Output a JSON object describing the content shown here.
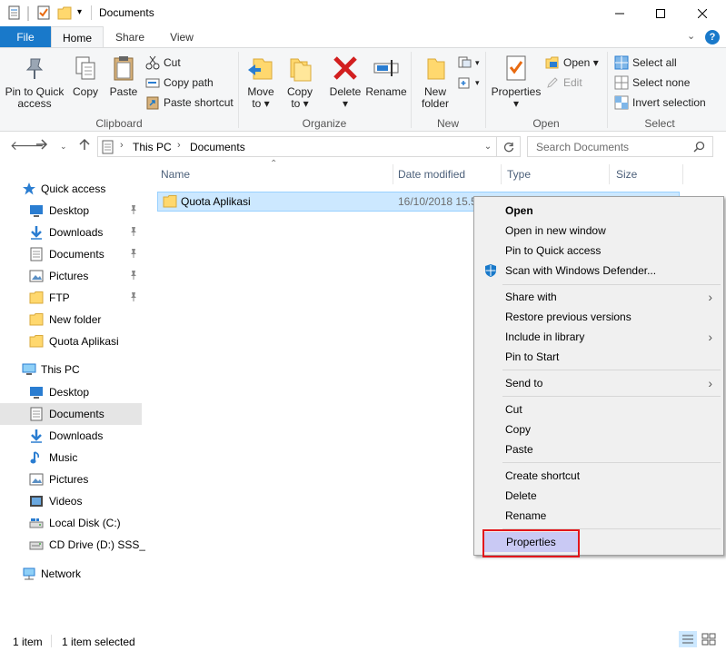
{
  "window": {
    "title": "Documents"
  },
  "ribbon": {
    "tabs": [
      "File",
      "Home",
      "Share",
      "View"
    ],
    "clipboard": {
      "group_label": "Clipboard",
      "pin_label_1": "Pin to Quick",
      "pin_label_2": "access",
      "copy": "Copy",
      "paste": "Paste",
      "cut": "Cut",
      "copy_path": "Copy path",
      "paste_shortcut": "Paste shortcut"
    },
    "organize": {
      "group_label": "Organize",
      "move_to_1": "Move",
      "move_to_2": "to ▾",
      "copy_to_1": "Copy",
      "copy_to_2": "to ▾",
      "delete_1": "Delete",
      "delete_2": "▾",
      "rename": "Rename"
    },
    "new": {
      "group_label": "New",
      "new_folder_1": "New",
      "new_folder_2": "folder"
    },
    "open": {
      "group_label": "Open",
      "properties_1": "Properties",
      "properties_2": "▾",
      "open": "Open ▾",
      "edit": "Edit"
    },
    "select": {
      "group_label": "Select",
      "select_all": "Select all",
      "select_none": "Select none",
      "invert_selection": "Invert selection"
    }
  },
  "address": {
    "crumbs": [
      "This PC",
      "Documents"
    ],
    "search_placeholder": "Search Documents"
  },
  "navpane": {
    "quick_access": "Quick access",
    "quick_items": [
      "Desktop",
      "Downloads",
      "Documents",
      "Pictures",
      "FTP",
      "New folder",
      "Quota Aplikasi"
    ],
    "this_pc": "This PC",
    "pc_items": [
      "Desktop",
      "Documents",
      "Downloads",
      "Music",
      "Pictures",
      "Videos",
      "Local Disk (C:)",
      "CD Drive (D:) SSS_X6"
    ],
    "network": "Network"
  },
  "filelist": {
    "columns": [
      "Name",
      "Date modified",
      "Type",
      "Size"
    ],
    "rows": [
      {
        "name": "Quota Aplikasi",
        "date": "16/10/2018 15.5"
      }
    ]
  },
  "context_menu": {
    "items": [
      "Open",
      "Open in new window",
      "Pin to Quick access",
      "Scan with Windows Defender...",
      "Share with",
      "Restore previous versions",
      "Include in library",
      "Pin to Start",
      "Send to",
      "Cut",
      "Copy",
      "Paste",
      "Create shortcut",
      "Delete",
      "Rename",
      "Properties"
    ]
  },
  "status": {
    "count": "1 item",
    "selected": "1 item selected"
  },
  "colors": {
    "accent": "#1979ca",
    "selection": "#cce8ff",
    "highlight_box": "#e3161b",
    "properties_hover": "#c9c9f4"
  }
}
